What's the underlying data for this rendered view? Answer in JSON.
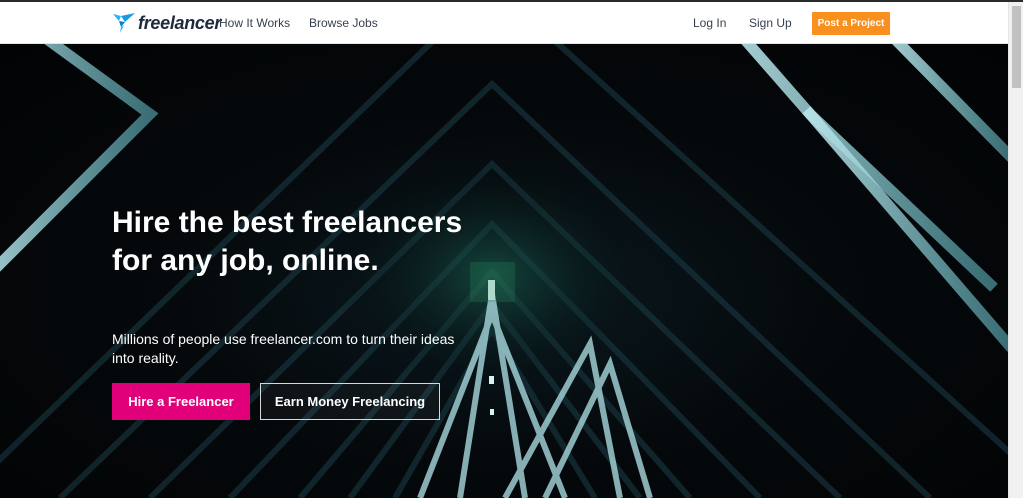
{
  "nav": {
    "brand": "freelancer",
    "how_it_works": "How It Works",
    "browse_jobs": "Browse Jobs",
    "log_in": "Log In",
    "sign_up": "Sign Up",
    "post_project": "Post a Project"
  },
  "hero": {
    "title": "Hire the best freelancers for any job, online.",
    "subtitle": "Millions of people use freelancer.com to turn their ideas into reality.",
    "hire_button": "Hire a Freelancer",
    "earn_button": "Earn Money Freelancing"
  },
  "colors": {
    "accent_orange": "#f7901e",
    "hire_pink": "#e2007a",
    "logo_blue": "#29b2fe",
    "hero_dark": "#05090c"
  },
  "icons": {
    "brand_logo": "freelancer-bird-logo-icon"
  }
}
